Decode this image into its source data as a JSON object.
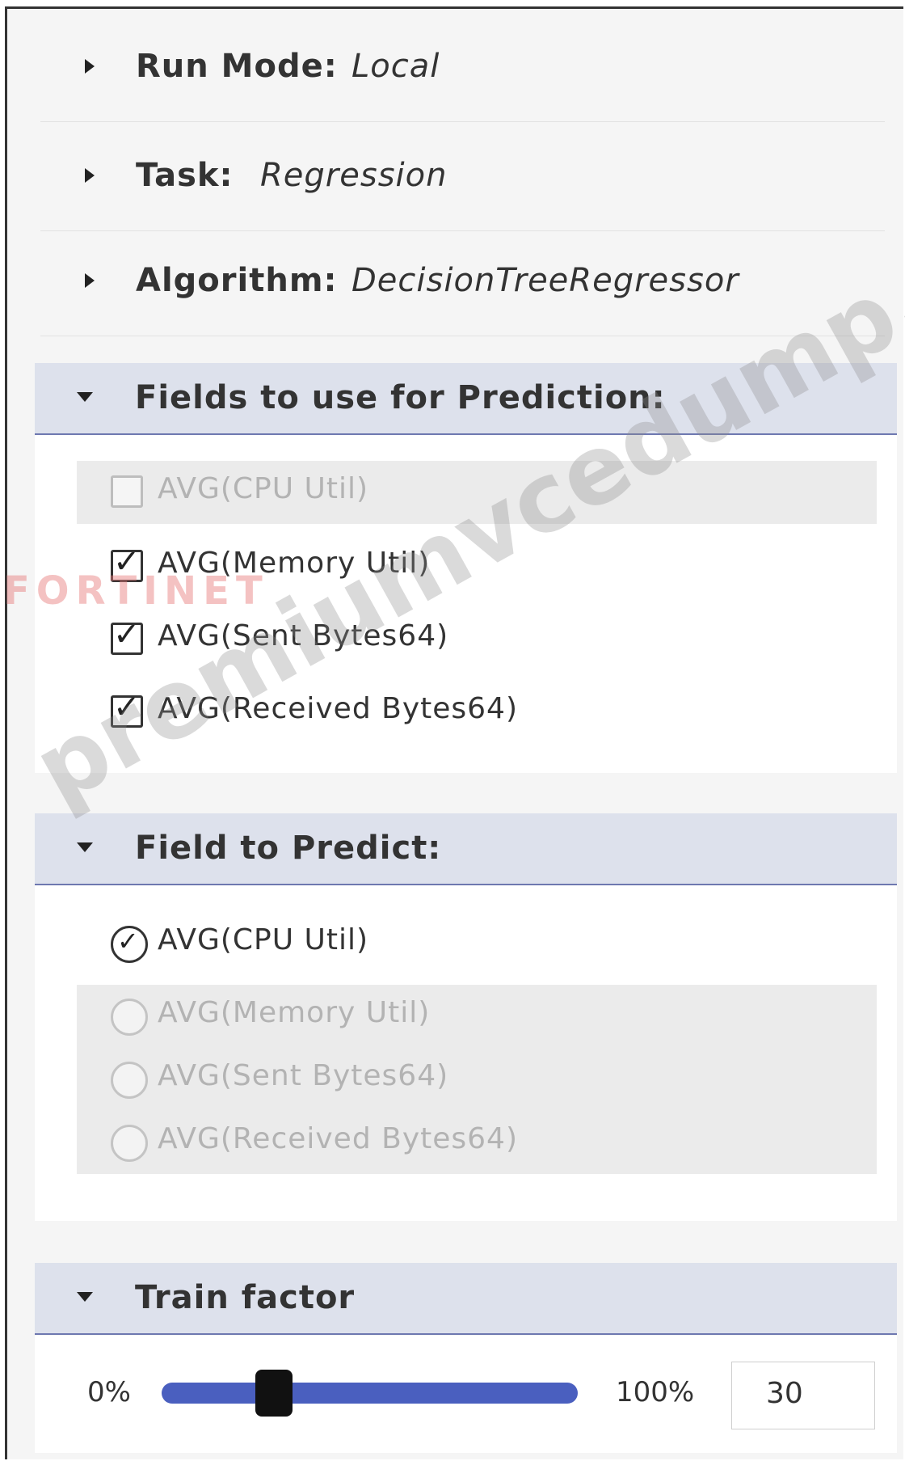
{
  "rows": [
    {
      "label": "Run Mode:",
      "value": "Local"
    },
    {
      "label": "Task:",
      "value": "Regression"
    },
    {
      "label": "Algorithm:",
      "value": "DecisionTreeRegressor"
    }
  ],
  "fields_section": {
    "title": "Fields to use for Prediction:",
    "options": [
      {
        "label": "AVG(CPU Util)",
        "checked": false,
        "disabled": true
      },
      {
        "label": "AVG(Memory Util)",
        "checked": true,
        "disabled": false
      },
      {
        "label": "AVG(Sent Bytes64)",
        "checked": true,
        "disabled": false
      },
      {
        "label": "AVG(Received Bytes64)",
        "checked": true,
        "disabled": false
      }
    ]
  },
  "predict_section": {
    "title": "Field to Predict:",
    "options": [
      {
        "label": "AVG(CPU Util)",
        "selected": true,
        "disabled": false
      },
      {
        "label": "AVG(Memory Util)",
        "selected": false,
        "disabled": true
      },
      {
        "label": "AVG(Sent Bytes64)",
        "selected": false,
        "disabled": true
      },
      {
        "label": "AVG(Received Bytes64)",
        "selected": false,
        "disabled": true
      }
    ]
  },
  "train_section": {
    "title": "Train factor",
    "min_label": "0%",
    "max_label": "100%",
    "value": "30",
    "slider_fraction": 0.27
  },
  "watermark": {
    "brand": "FORTINET",
    "site": "premiumvcedump.com"
  },
  "icons": {
    "collapsed": "triangle-right-icon",
    "expanded": "triangle-down-icon",
    "check": "check-icon"
  }
}
